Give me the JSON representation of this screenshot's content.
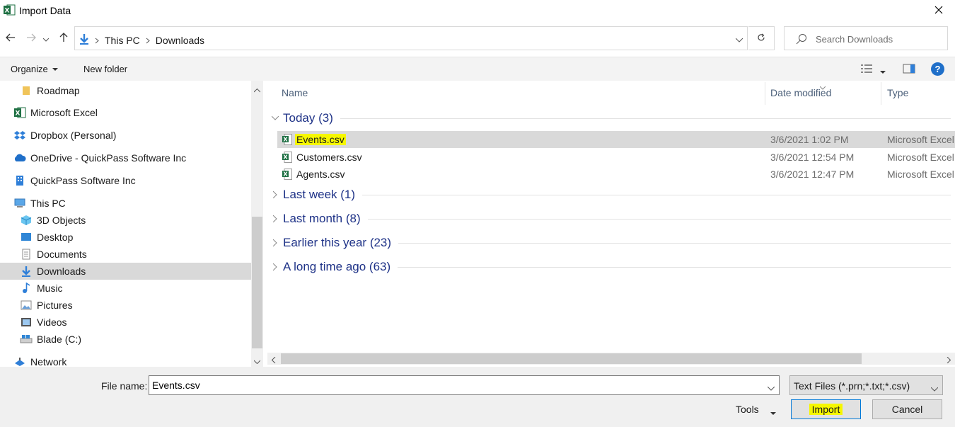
{
  "window": {
    "title": "Import Data",
    "app_icon": "excel-icon"
  },
  "nav": {
    "path": [
      "This PC",
      "Downloads"
    ],
    "search_placeholder": "Search Downloads"
  },
  "toolbar": {
    "organize_label": "Organize",
    "new_folder_label": "New folder",
    "help_label": "?"
  },
  "tree": [
    {
      "label": "Roadmap",
      "icon": "folder-icon",
      "indent": 2
    },
    {
      "label": "Microsoft Excel",
      "icon": "excel-icon",
      "indent": 1
    },
    {
      "label": "Dropbox (Personal)",
      "icon": "dropbox-icon",
      "indent": 1
    },
    {
      "label": "OneDrive - QuickPass Software Inc",
      "icon": "onedrive-icon",
      "indent": 1
    },
    {
      "label": "QuickPass Software Inc",
      "icon": "building-icon",
      "indent": 1
    },
    {
      "label": "This PC",
      "icon": "computer-icon",
      "indent": 1
    },
    {
      "label": "3D Objects",
      "icon": "cube-icon",
      "indent": 2
    },
    {
      "label": "Desktop",
      "icon": "desktop-icon",
      "indent": 2
    },
    {
      "label": "Documents",
      "icon": "documents-icon",
      "indent": 2
    },
    {
      "label": "Downloads",
      "icon": "download-icon",
      "indent": 2,
      "selected": true
    },
    {
      "label": "Music",
      "icon": "music-icon",
      "indent": 2
    },
    {
      "label": "Pictures",
      "icon": "pictures-icon",
      "indent": 2
    },
    {
      "label": "Videos",
      "icon": "videos-icon",
      "indent": 2
    },
    {
      "label": "Blade (C:)",
      "icon": "drive-icon",
      "indent": 2
    },
    {
      "label": "Network",
      "icon": "network-icon",
      "indent": 1
    }
  ],
  "columns": {
    "name": "Name",
    "date": "Date modified",
    "type": "Type"
  },
  "groups": {
    "today": {
      "label": "Today (3)",
      "expanded": true
    },
    "last_week": {
      "label": "Last week (1)"
    },
    "last_month": {
      "label": "Last month (8)"
    },
    "earlier_year": {
      "label": "Earlier this year (23)"
    },
    "long_ago": {
      "label": "A long time ago (63)"
    }
  },
  "files": [
    {
      "name": "Events.csv",
      "date": "3/6/2021 1:02 PM",
      "type": "Microsoft Excel C",
      "selected": true,
      "highlighted": true
    },
    {
      "name": "Customers.csv",
      "date": "3/6/2021 12:54 PM",
      "type": "Microsoft Excel C"
    },
    {
      "name": "Agents.csv",
      "date": "3/6/2021 12:47 PM",
      "type": "Microsoft Excel C"
    }
  ],
  "footer": {
    "file_name_label": "File name:",
    "file_name_value": "Events.csv",
    "file_type": "Text Files (*.prn;*.txt;*.csv)",
    "tools_label": "Tools",
    "import_label": "Import",
    "cancel_label": "Cancel"
  },
  "colors": {
    "highlight": "#f6f700",
    "group_text": "#1e3287",
    "selected_bg": "#d9d9d9"
  }
}
